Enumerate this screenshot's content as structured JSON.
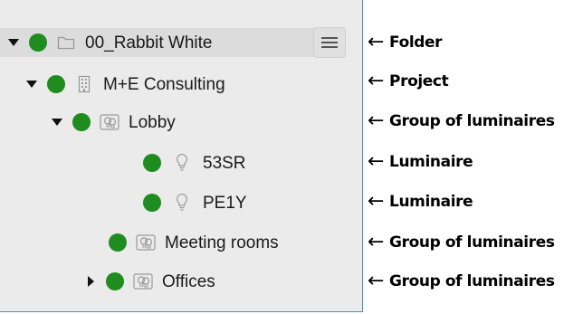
{
  "tree": {
    "nodes": [
      {
        "label": "00_Rabbit White",
        "icon": "folder-icon",
        "expanded": true,
        "status_color": "#1e8c1e"
      },
      {
        "label": "M+E Consulting",
        "icon": "building-icon",
        "expanded": true,
        "status_color": "#1e8c1e"
      },
      {
        "label": "Lobby",
        "icon": "luminaire-group-icon",
        "expanded": true,
        "status_color": "#1e8c1e"
      },
      {
        "label": "53SR",
        "icon": "lightbulb-icon",
        "status_color": "#1e8c1e"
      },
      {
        "label": "PE1Y",
        "icon": "lightbulb-icon",
        "status_color": "#1e8c1e"
      },
      {
        "label": "Meeting rooms",
        "icon": "luminaire-group-icon",
        "status_color": "#1e8c1e"
      },
      {
        "label": "Offices",
        "icon": "luminaire-group-icon",
        "expanded": false,
        "status_color": "#1e8c1e"
      }
    ],
    "menu_icon": "hamburger-menu-icon"
  },
  "annotations": {
    "arrow": "←",
    "items": [
      "Folder",
      "Project",
      "Group of luminaires",
      "Luminaire",
      "Luminaire",
      "Group of luminaires",
      "Group of luminaires"
    ]
  },
  "colors": {
    "status_ok": "#1e8c1e",
    "panel_background": "#ebebeb",
    "panel_border": "#4a90c9"
  }
}
